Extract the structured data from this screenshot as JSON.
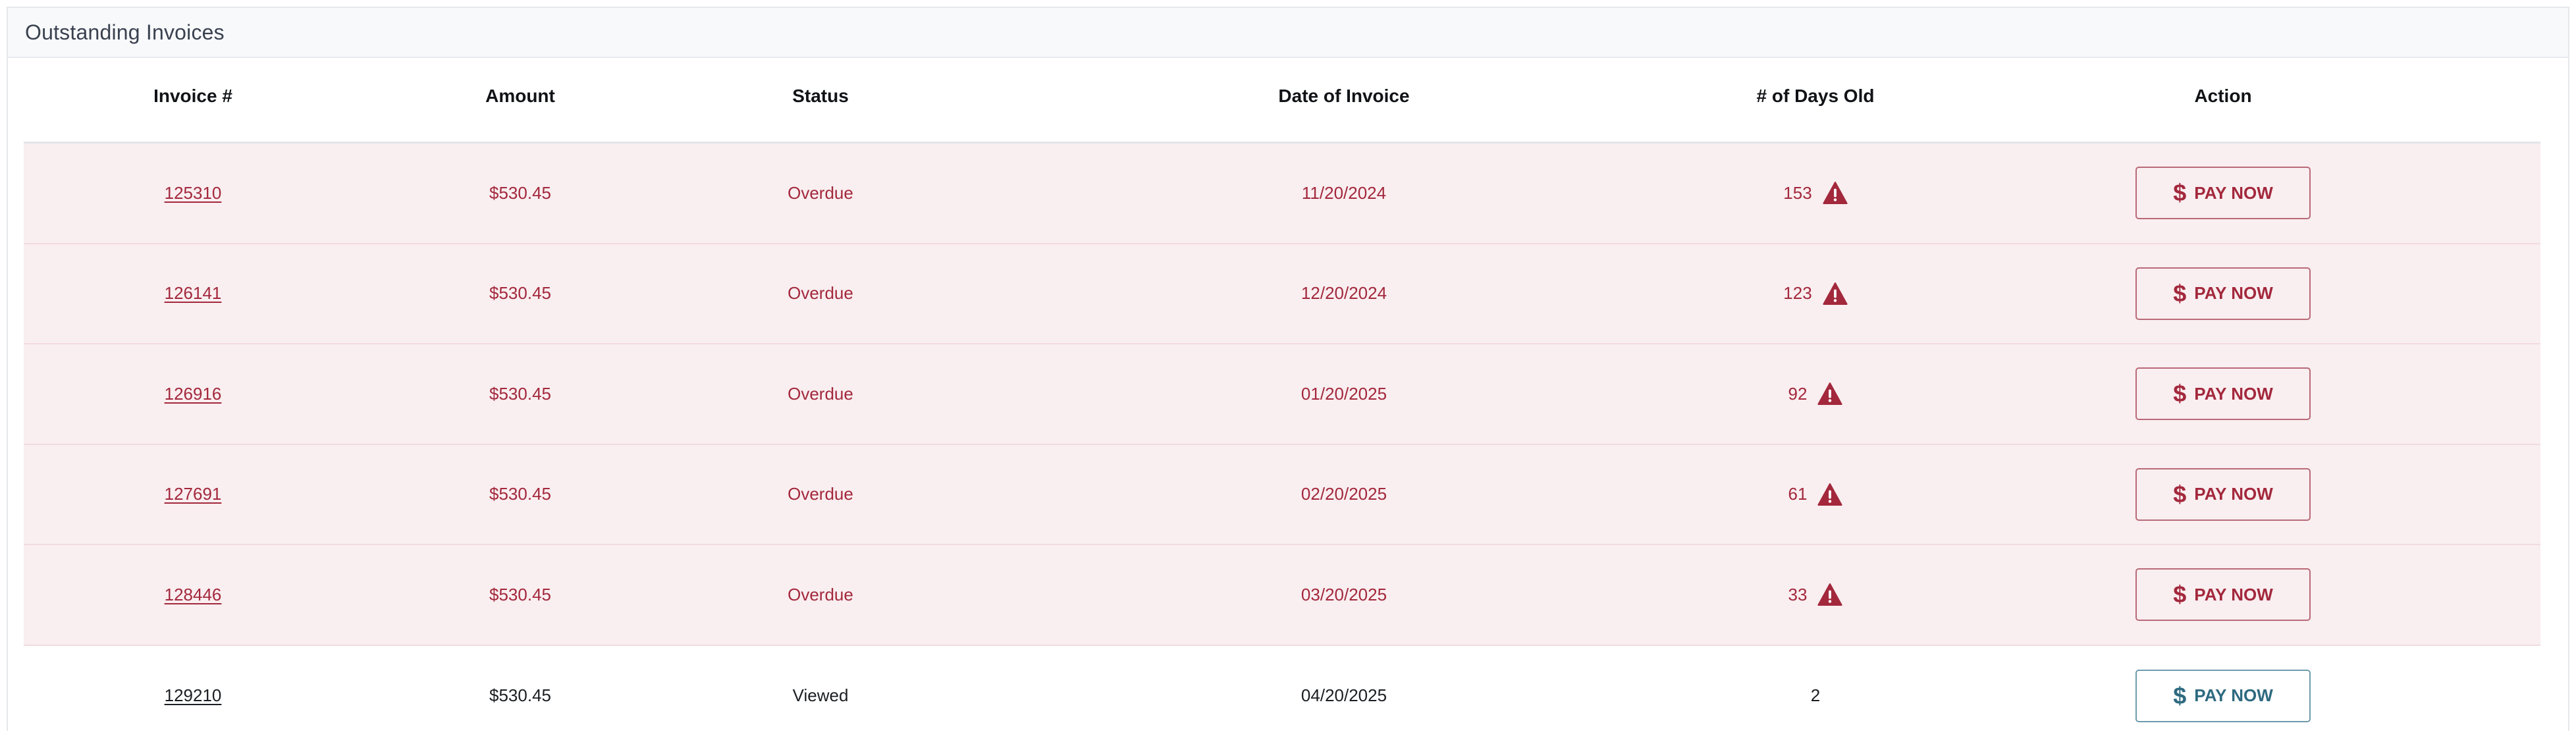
{
  "panel": {
    "title": "Outstanding Invoices"
  },
  "table": {
    "headers": {
      "invoice": "Invoice #",
      "amount": "Amount",
      "status": "Status",
      "date": "Date of Invoice",
      "days": "# of Days Old",
      "action": "Action"
    },
    "rows": [
      {
        "invoice": "125310",
        "amount": "$530.45",
        "status": "Overdue",
        "date": "11/20/2024",
        "days": "153",
        "warning": true,
        "action": "PAY NOW"
      },
      {
        "invoice": "126141",
        "amount": "$530.45",
        "status": "Overdue",
        "date": "12/20/2024",
        "days": "123",
        "warning": true,
        "action": "PAY NOW"
      },
      {
        "invoice": "126916",
        "amount": "$530.45",
        "status": "Overdue",
        "date": "01/20/2025",
        "days": "92",
        "warning": true,
        "action": "PAY NOW"
      },
      {
        "invoice": "127691",
        "amount": "$530.45",
        "status": "Overdue",
        "date": "02/20/2025",
        "days": "61",
        "warning": true,
        "action": "PAY NOW"
      },
      {
        "invoice": "128446",
        "amount": "$530.45",
        "status": "Overdue",
        "date": "03/20/2025",
        "days": "33",
        "warning": true,
        "action": "PAY NOW"
      },
      {
        "invoice": "129210",
        "amount": "$530.45",
        "status": "Viewed",
        "date": "04/20/2025",
        "days": "2",
        "warning": false,
        "action": "PAY NOW"
      }
    ]
  },
  "icons": {
    "warning": "warning-triangle-icon",
    "dollar": "dollar-icon"
  },
  "colors": {
    "overdue_text": "#a3283c",
    "overdue_row_bg": "#f9eef0",
    "normal_button": "#2e6a80"
  }
}
